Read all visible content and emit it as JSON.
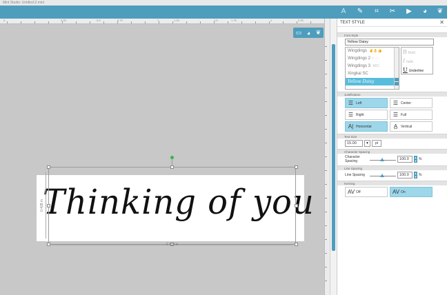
{
  "window": {
    "title": "Mint Studio: Untitled-2.mint"
  },
  "toolbar": {
    "tools": [
      {
        "name": "text-style",
        "icon": "A",
        "active": true
      },
      {
        "name": "fill",
        "icon": "✎"
      },
      {
        "name": "crop",
        "icon": "⌗"
      },
      {
        "name": "trace",
        "icon": "✂"
      },
      {
        "name": "record",
        "icon": "▶"
      },
      {
        "name": "palette",
        "icon": "◕"
      },
      {
        "name": "leaf",
        "icon": "❦"
      }
    ]
  },
  "ruler": {
    "h_labels": [
      "0.25",
      "0.5",
      "0.75",
      "1",
      "1.25",
      "1.5",
      "1.75",
      "2",
      "2.25"
    ]
  },
  "canvas": {
    "text_content": "Thinking of you",
    "width_label": "2.139 in",
    "height_label": "0.428 in"
  },
  "panel": {
    "title": "TEXT STYLE",
    "close": "✕",
    "font_style": {
      "section_title": "Font Style",
      "selected_font": "Yellow Daisy",
      "fonts": [
        {
          "name": "Wingdings",
          "sample": "✌👌👍"
        },
        {
          "name": "Wingdings 2",
          "sample": "•→↑"
        },
        {
          "name": "Wingdings 3",
          "sample": "ABC"
        },
        {
          "name": "Xingkai SC",
          "sample": ""
        },
        {
          "name": "Yellow Daisy",
          "sample": ""
        }
      ],
      "styles": [
        {
          "glyph": "B",
          "label": "Bold"
        },
        {
          "glyph": "I",
          "label": "Italic"
        },
        {
          "glyph": "U",
          "label": "Underline"
        }
      ]
    },
    "justification": {
      "section_title": "Justification",
      "left": "Left",
      "center": "Center",
      "right": "Right",
      "full": "Full",
      "horizontal": "Horizontal",
      "vertical": "Vertical"
    },
    "text_size": {
      "section_title": "Text Size",
      "value": "15.00",
      "dropdown": "▼",
      "unit": "pt"
    },
    "character_spacing": {
      "section_title": "Character Spacing",
      "label": "Character Spacing",
      "value": "100.0",
      "unit": "%"
    },
    "line_spacing": {
      "section_title": "Line Spacing",
      "label": "Line Spacing",
      "value": "100.0",
      "unit": "%"
    },
    "kerning": {
      "section_title": "Kerning",
      "off": "Off",
      "on": "On",
      "icon": "AV"
    }
  },
  "colors": {
    "accent": "#4f9dbd",
    "selected": "#58bcdc",
    "option_on": "#9ed7ea"
  }
}
